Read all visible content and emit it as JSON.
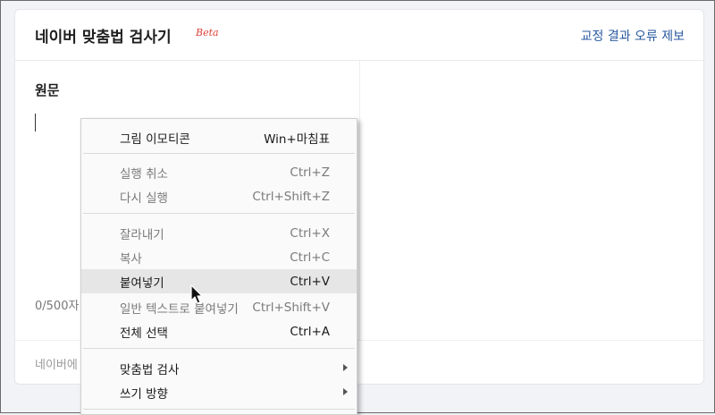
{
  "header": {
    "title": "네이버 맞춤법 검사기",
    "beta": "Beta",
    "report_link": "교정 결과 오류 제보"
  },
  "original": {
    "label": "원문",
    "char_count": "0/500자",
    "footer_text": "네이버에"
  },
  "context_menu": {
    "items": [
      {
        "label": "그림 이모티콘",
        "shortcut": "Win+마침표",
        "enabled": true
      },
      {
        "label": "실행 취소",
        "shortcut": "Ctrl+Z",
        "enabled": false
      },
      {
        "label": "다시 실행",
        "shortcut": "Ctrl+Shift+Z",
        "enabled": false
      },
      {
        "label": "잘라내기",
        "shortcut": "Ctrl+X",
        "enabled": false
      },
      {
        "label": "복사",
        "shortcut": "Ctrl+C",
        "enabled": false
      },
      {
        "label": "붙여넣기",
        "shortcut": "Ctrl+V",
        "enabled": true,
        "hovered": true
      },
      {
        "label": "일반 텍스트로 붙여넣기",
        "shortcut": "Ctrl+Shift+V",
        "enabled": false
      },
      {
        "label": "전체 선택",
        "shortcut": "Ctrl+A",
        "enabled": true
      },
      {
        "label": "맞춤법 검사",
        "submenu": true,
        "enabled": true
      },
      {
        "label": "쓰기 방향",
        "submenu": true,
        "enabled": true
      }
    ]
  },
  "colors": {
    "beta": "#e0423b",
    "link": "#2a5aa0",
    "hover_bg": "#e6e6e6"
  },
  "icons": [
    "arrow-pointer-icon",
    "chevron-right-icon"
  ]
}
